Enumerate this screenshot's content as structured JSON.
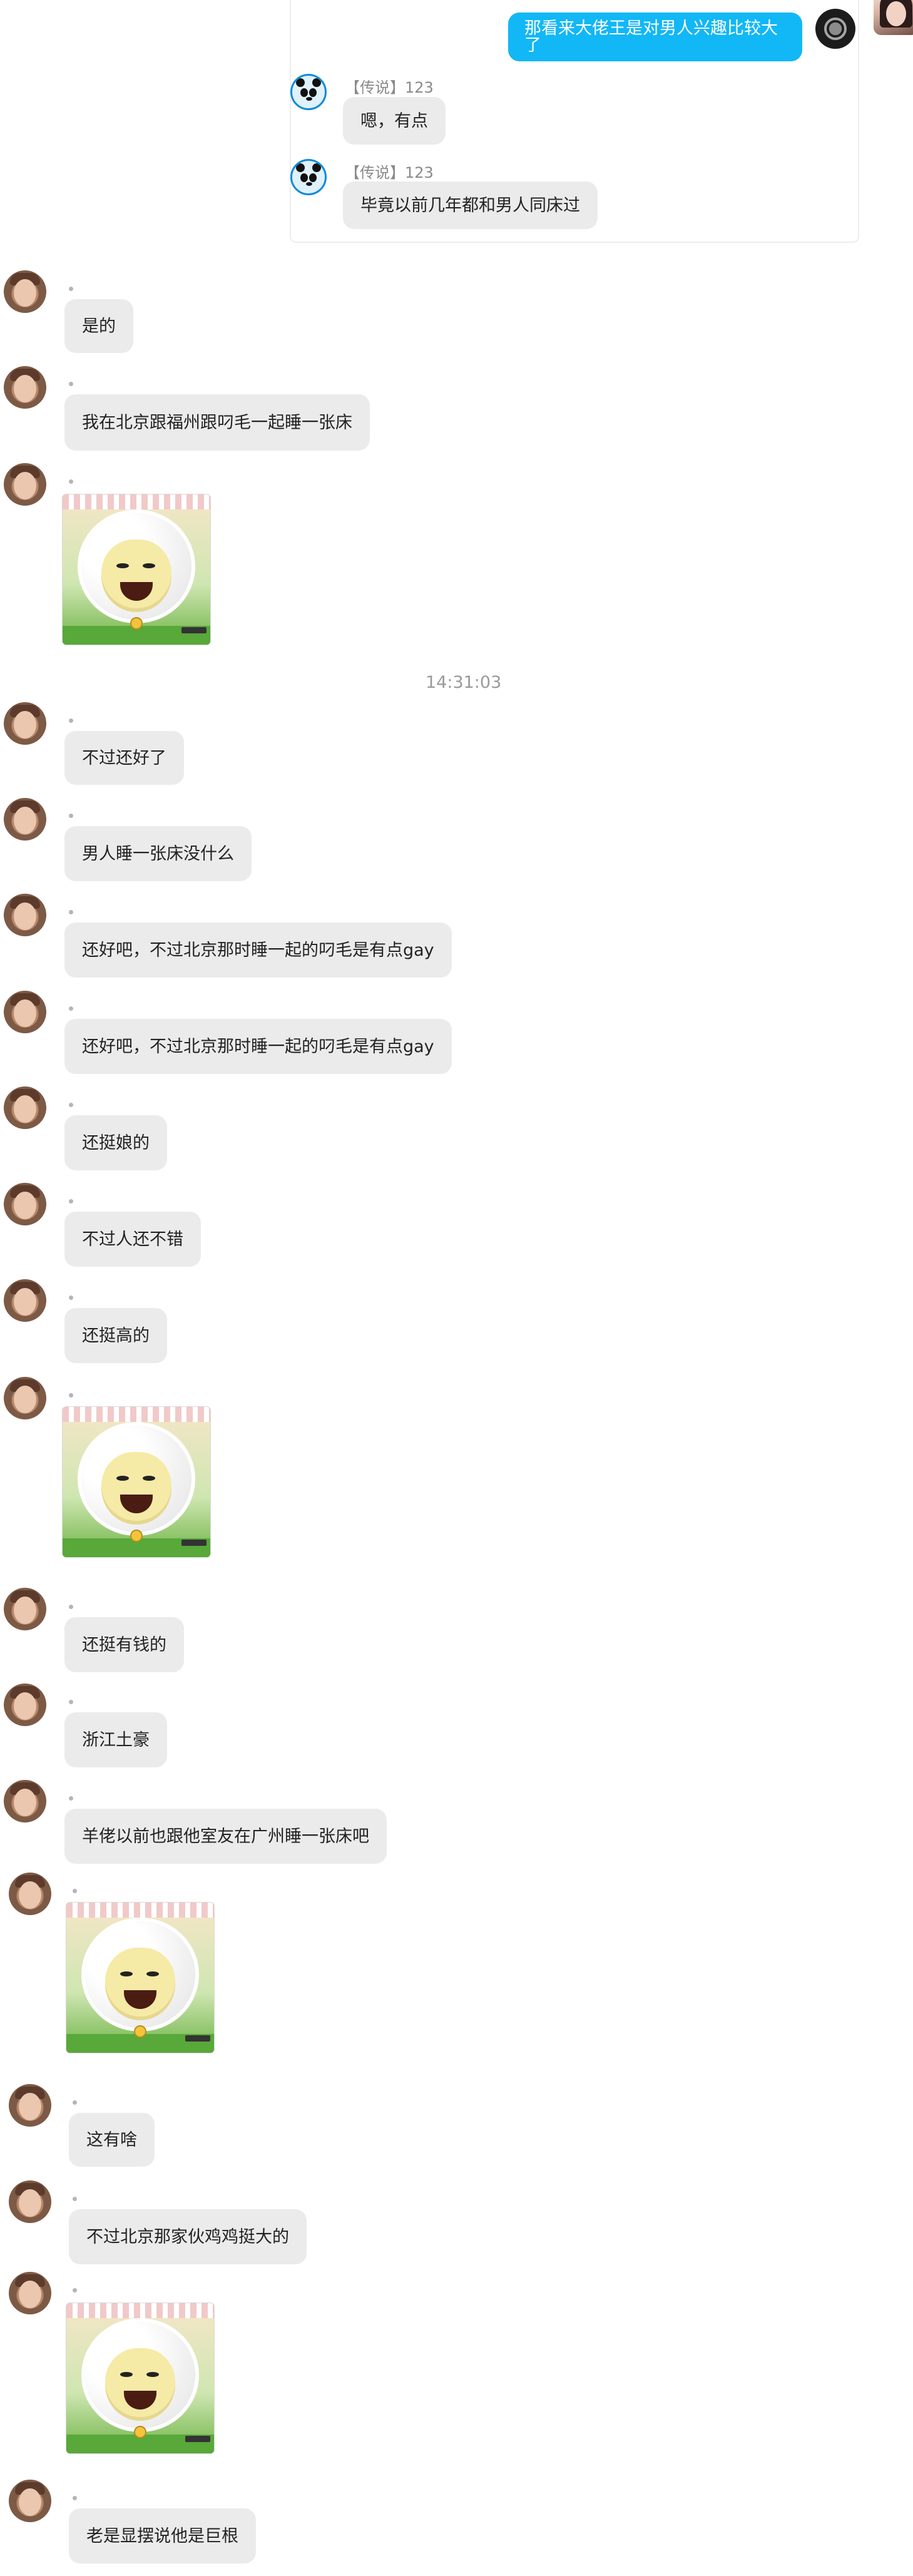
{
  "quote": {
    "outgoing": {
      "text": "那看来大佬王是对男人兴趣比较大了"
    },
    "replies": [
      {
        "name": "【传说】123",
        "text": "嗯，有点"
      },
      {
        "name": "【传说】123",
        "text": "毕竟以前几年都和男人同床过"
      }
    ]
  },
  "messages": [
    {
      "text": "是的"
    },
    {
      "text": "我在北京跟福州跟叼毛一起睡一张床"
    },
    {
      "sticker": "laughing-sheep-sticker"
    },
    {
      "timestamp": "14:31:03"
    },
    {
      "text": "不过还好了"
    },
    {
      "text": "男人睡一张床没什么"
    },
    {
      "text": "还好吧，不过北京那时睡一起的叼毛是有点gay"
    },
    {
      "text": "还好吧，不过北京那时睡一起的叼毛是有点gay"
    },
    {
      "text": "还挺娘的"
    },
    {
      "text": "不过人还不错"
    },
    {
      "text": "还挺高的"
    },
    {
      "sticker": "laughing-sheep-sticker"
    },
    {
      "text": "还挺有钱的"
    },
    {
      "text": "浙江土豪"
    },
    {
      "text": "羊佬以前也跟他室友在广州睡一张床吧"
    },
    {
      "sticker": "laughing-sheep-sticker"
    },
    {
      "text": "这有啥"
    },
    {
      "text": "不过北京那家伙鸡鸡挺大的"
    },
    {
      "sticker": "laughing-sheep-sticker"
    },
    {
      "text": "老是显摆说他是巨根"
    }
  ],
  "colors": {
    "outgoing_bubble": "#12b7f5",
    "incoming_bubble": "#ebebeb",
    "timestamp": "#9a9a9a"
  }
}
